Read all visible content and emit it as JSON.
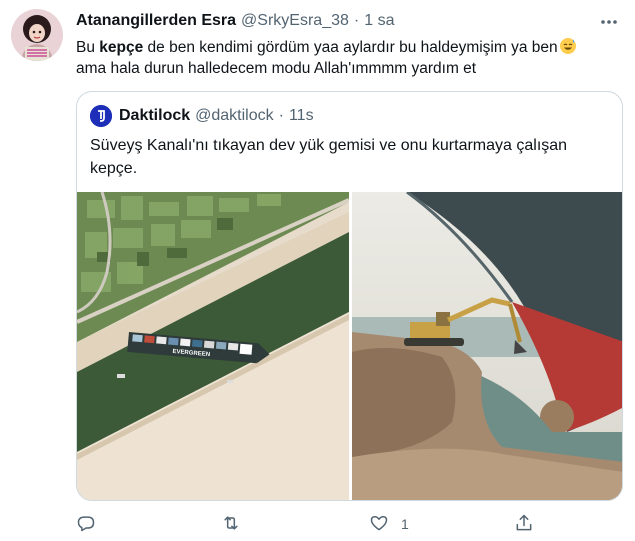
{
  "tweet": {
    "author_name": "Atanangillerden Esra",
    "author_handle": "@SrkyEsra_38",
    "separator": "·",
    "time": "1 sa",
    "text_line1_pre": "Bu ",
    "text_line1_bold": "kepçe",
    "text_line1_post": " de ben kendimi gördüm yaa aylardır bu haldeymişim ya ben",
    "text_line2": "ama hala durun halledecem modu Allah'ımmmm yardım et",
    "emoji": "sweat-smile-emoji"
  },
  "quoted": {
    "author_name": "Daktilock",
    "author_handle": "@daktilock",
    "separator": "·",
    "time": "11s",
    "text_line1": "Süveyş Kanalı'nı tıkayan dev yük gemisi ve onu kurtarmaya çalışan",
    "text_line2": "kepçe.",
    "images": [
      "satellite-canal-ship-image",
      "excavator-ship-bow-image"
    ],
    "ship_text": "EVERGREEN"
  },
  "actions": {
    "reply_icon": "reply-icon",
    "retweet_icon": "retweet-icon",
    "like_icon": "heart-icon",
    "like_count": "1",
    "share_icon": "share-icon"
  },
  "colors": {
    "text": "#0f1419",
    "muted": "#536471",
    "border": "#cfd9de",
    "daktilock_avatar": "#1d2fb8"
  }
}
